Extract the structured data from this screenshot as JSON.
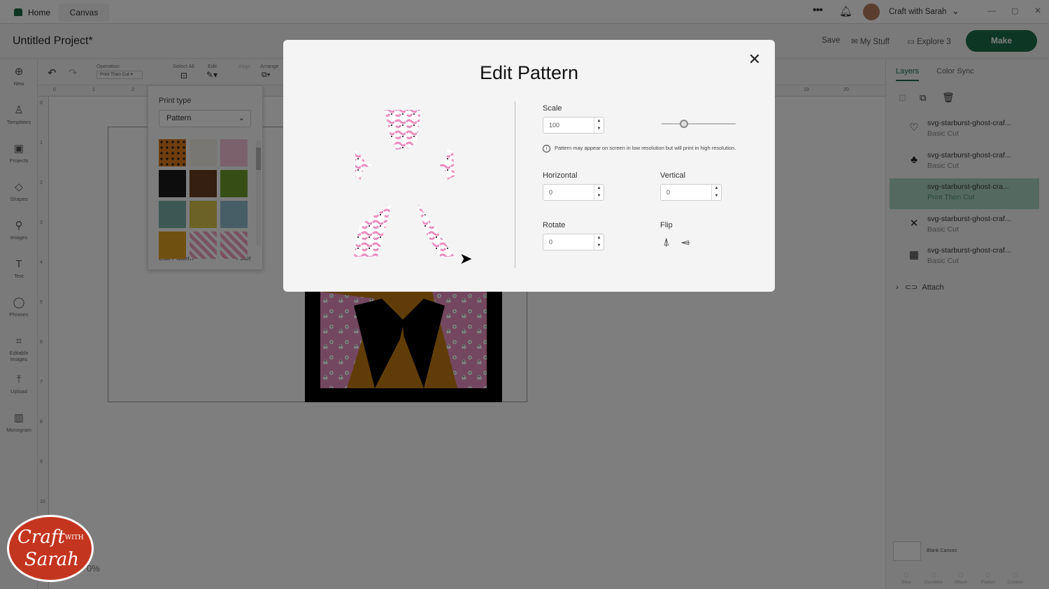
{
  "topbar": {
    "home": "Home",
    "canvas": "Canvas",
    "user": "Craft with Sarah"
  },
  "header": {
    "project_title": "Untitled Project*",
    "save": "Save",
    "my_stuff": "My Stuff",
    "machine": "Explore 3",
    "make": "Make"
  },
  "toolbar": {
    "operation_label": "Operation",
    "operation_value": "Print Then Cut",
    "select_all": "Select All",
    "edit": "Edit",
    "align": "Align",
    "arrange": "Arrange"
  },
  "leftbar": [
    {
      "label": "New",
      "icon": "plus-circle-icon",
      "glyph": "⊕"
    },
    {
      "label": "Templates",
      "icon": "shirt-icon",
      "glyph": "♙"
    },
    {
      "label": "Projects",
      "icon": "projects-icon",
      "glyph": "▣"
    },
    {
      "label": "Shapes",
      "icon": "shapes-icon",
      "glyph": "◇"
    },
    {
      "label": "Images",
      "icon": "bulb-icon",
      "glyph": "⚲"
    },
    {
      "label": "Text",
      "icon": "text-icon",
      "glyph": "T"
    },
    {
      "label": "Phrases",
      "icon": "chat-icon",
      "glyph": "◯"
    },
    {
      "label": "Editable",
      "label2": "Images",
      "icon": "edit-image-icon",
      "glyph": "⌗"
    },
    {
      "label": "Upload",
      "icon": "upload-icon",
      "glyph": "⤒"
    },
    {
      "label": "Monogram",
      "icon": "monogram-icon",
      "glyph": "▥"
    }
  ],
  "ruler": {
    "top": [
      "0",
      "1",
      "2",
      "19",
      "20"
    ],
    "left": [
      "0",
      "1",
      "2",
      "3",
      "4",
      "5",
      "6",
      "7",
      "8",
      "9",
      "10"
    ]
  },
  "popover": {
    "title": "Print type",
    "select_value": "Pattern",
    "edit_pattern": "Edit Pattern",
    "filter": "Filter"
  },
  "right_panel": {
    "tabs": [
      "Layers",
      "Color Sync"
    ],
    "layers": [
      {
        "name": "svg-starburst-ghost-craf...",
        "op": "Basic Cut"
      },
      {
        "name": "svg-starburst-ghost-craf...",
        "op": "Basic Cut"
      },
      {
        "name": "svg-starburst-ghost-cra...",
        "op": "Print Then Cut"
      },
      {
        "name": "svg-starburst-ghost-craf...",
        "op": "Basic Cut"
      },
      {
        "name": "svg-starburst-ghost-craf...",
        "op": "Basic Cut"
      }
    ],
    "attach": "Attach",
    "blank_canvas": "Blank Canvas",
    "bottom": [
      "Slice",
      "Combine",
      "Attach",
      "Flatten",
      "Contour"
    ]
  },
  "zoom": "0%",
  "modal": {
    "title": "Edit Pattern",
    "scale_label": "Scale",
    "scale_value": "100",
    "note": "Pattern may appear on screen in low resolution but will print in high resolution.",
    "horizontal_label": "Horizontal",
    "horizontal_value": "0",
    "vertical_label": "Vertical",
    "vertical_value": "0",
    "rotate_label": "Rotate",
    "rotate_value": "0",
    "flip_label": "Flip",
    "scale_slider_level": 0.3
  },
  "watermark": {
    "line1": "Craft",
    "with": "WITH",
    "line2": "Sarah"
  },
  "colors": {
    "accent": "#1b6e48",
    "selected_layer": "#a8d5c1",
    "pattern_pink": "#e98fc0",
    "orange": "#c07a10",
    "watermark": "#c4351f"
  }
}
